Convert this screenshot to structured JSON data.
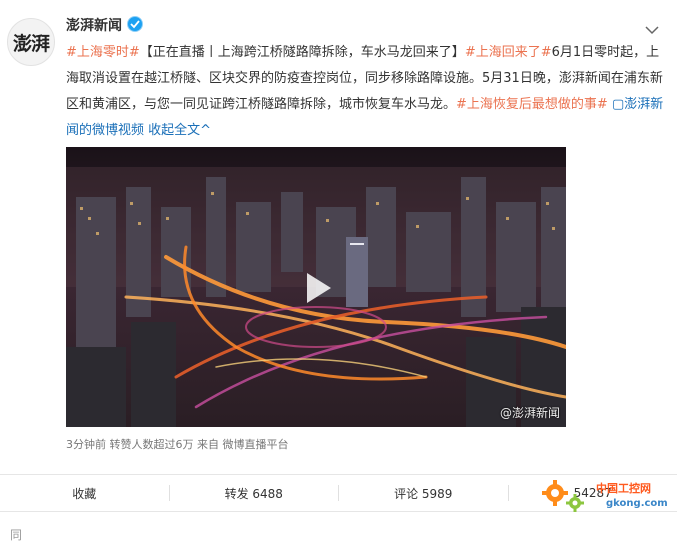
{
  "post": {
    "author_name": "澎湃新闻",
    "avatar_text": "澎湃",
    "text_segments": [
      {
        "t": "#上海零时#",
        "c": "link"
      },
      {
        "t": "【正在直播丨上海跨江桥隧路障拆除，车水马龙回来了】",
        "c": ""
      },
      {
        "t": "#上海回来了#",
        "c": "link"
      },
      {
        "t": "6月1日零时起，上海取消设置在越江桥隧、区块交界的防疫查控岗位，同步移除路障设施。5月31日晚，澎湃新闻在浦东新区和黄浦区，与您一同见证跨江桥隧路障拆除，城市恢复车水马龙。",
        "c": ""
      },
      {
        "t": "#上海恢复后最想做的事#",
        "c": "link"
      },
      {
        "t": " ▢澎湃新闻的微博视频 ",
        "c": "blue"
      },
      {
        "t": "收起全文^",
        "c": "blue"
      }
    ],
    "video_watermark": "@澎湃新闻",
    "meta": "3分钟前 转赞人数超过6万  来自 微博直播平台"
  },
  "actions": [
    {
      "label": "收藏"
    },
    {
      "label": "转发 6488"
    },
    {
      "label": "评论 5989"
    },
    {
      "label": "54287"
    }
  ],
  "watermark_logo": {
    "line1": "中国工控网",
    "line2": "gkong.com"
  },
  "bottom_text": "同"
}
